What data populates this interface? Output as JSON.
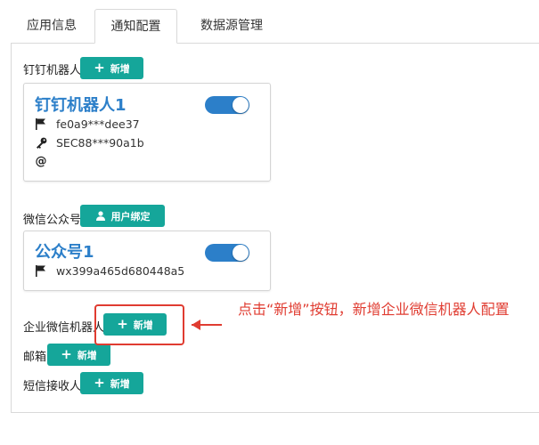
{
  "tabs": [
    {
      "label": "应用信息",
      "active": false
    },
    {
      "label": "通知配置",
      "active": true
    },
    {
      "label": "数据源管理",
      "active": false
    }
  ],
  "dingtalk": {
    "label": "钉钉机器人",
    "add_label": "新增",
    "card": {
      "title": "钉钉机器人1",
      "enabled": true,
      "token": "fe0a9***dee37",
      "secret": "SEC88***90a1b",
      "at": "@"
    }
  },
  "wechat_mp": {
    "label": "微信公众号",
    "bind_label": "用户绑定",
    "card": {
      "title": "公众号1",
      "enabled": true,
      "app_id": "wx399a465d680448a5"
    }
  },
  "wecom_robot": {
    "label": "企业微信机器人",
    "add_label": "新增"
  },
  "email": {
    "label": "邮箱",
    "add_label": "新增"
  },
  "sms": {
    "label": "短信接收人",
    "add_label": "新增"
  },
  "annotation": "点击“新增”按钮，新增企业微信机器人配置",
  "colors": {
    "accent": "#15a69a",
    "link": "#2c7fc9",
    "highlight": "#e03c31"
  }
}
